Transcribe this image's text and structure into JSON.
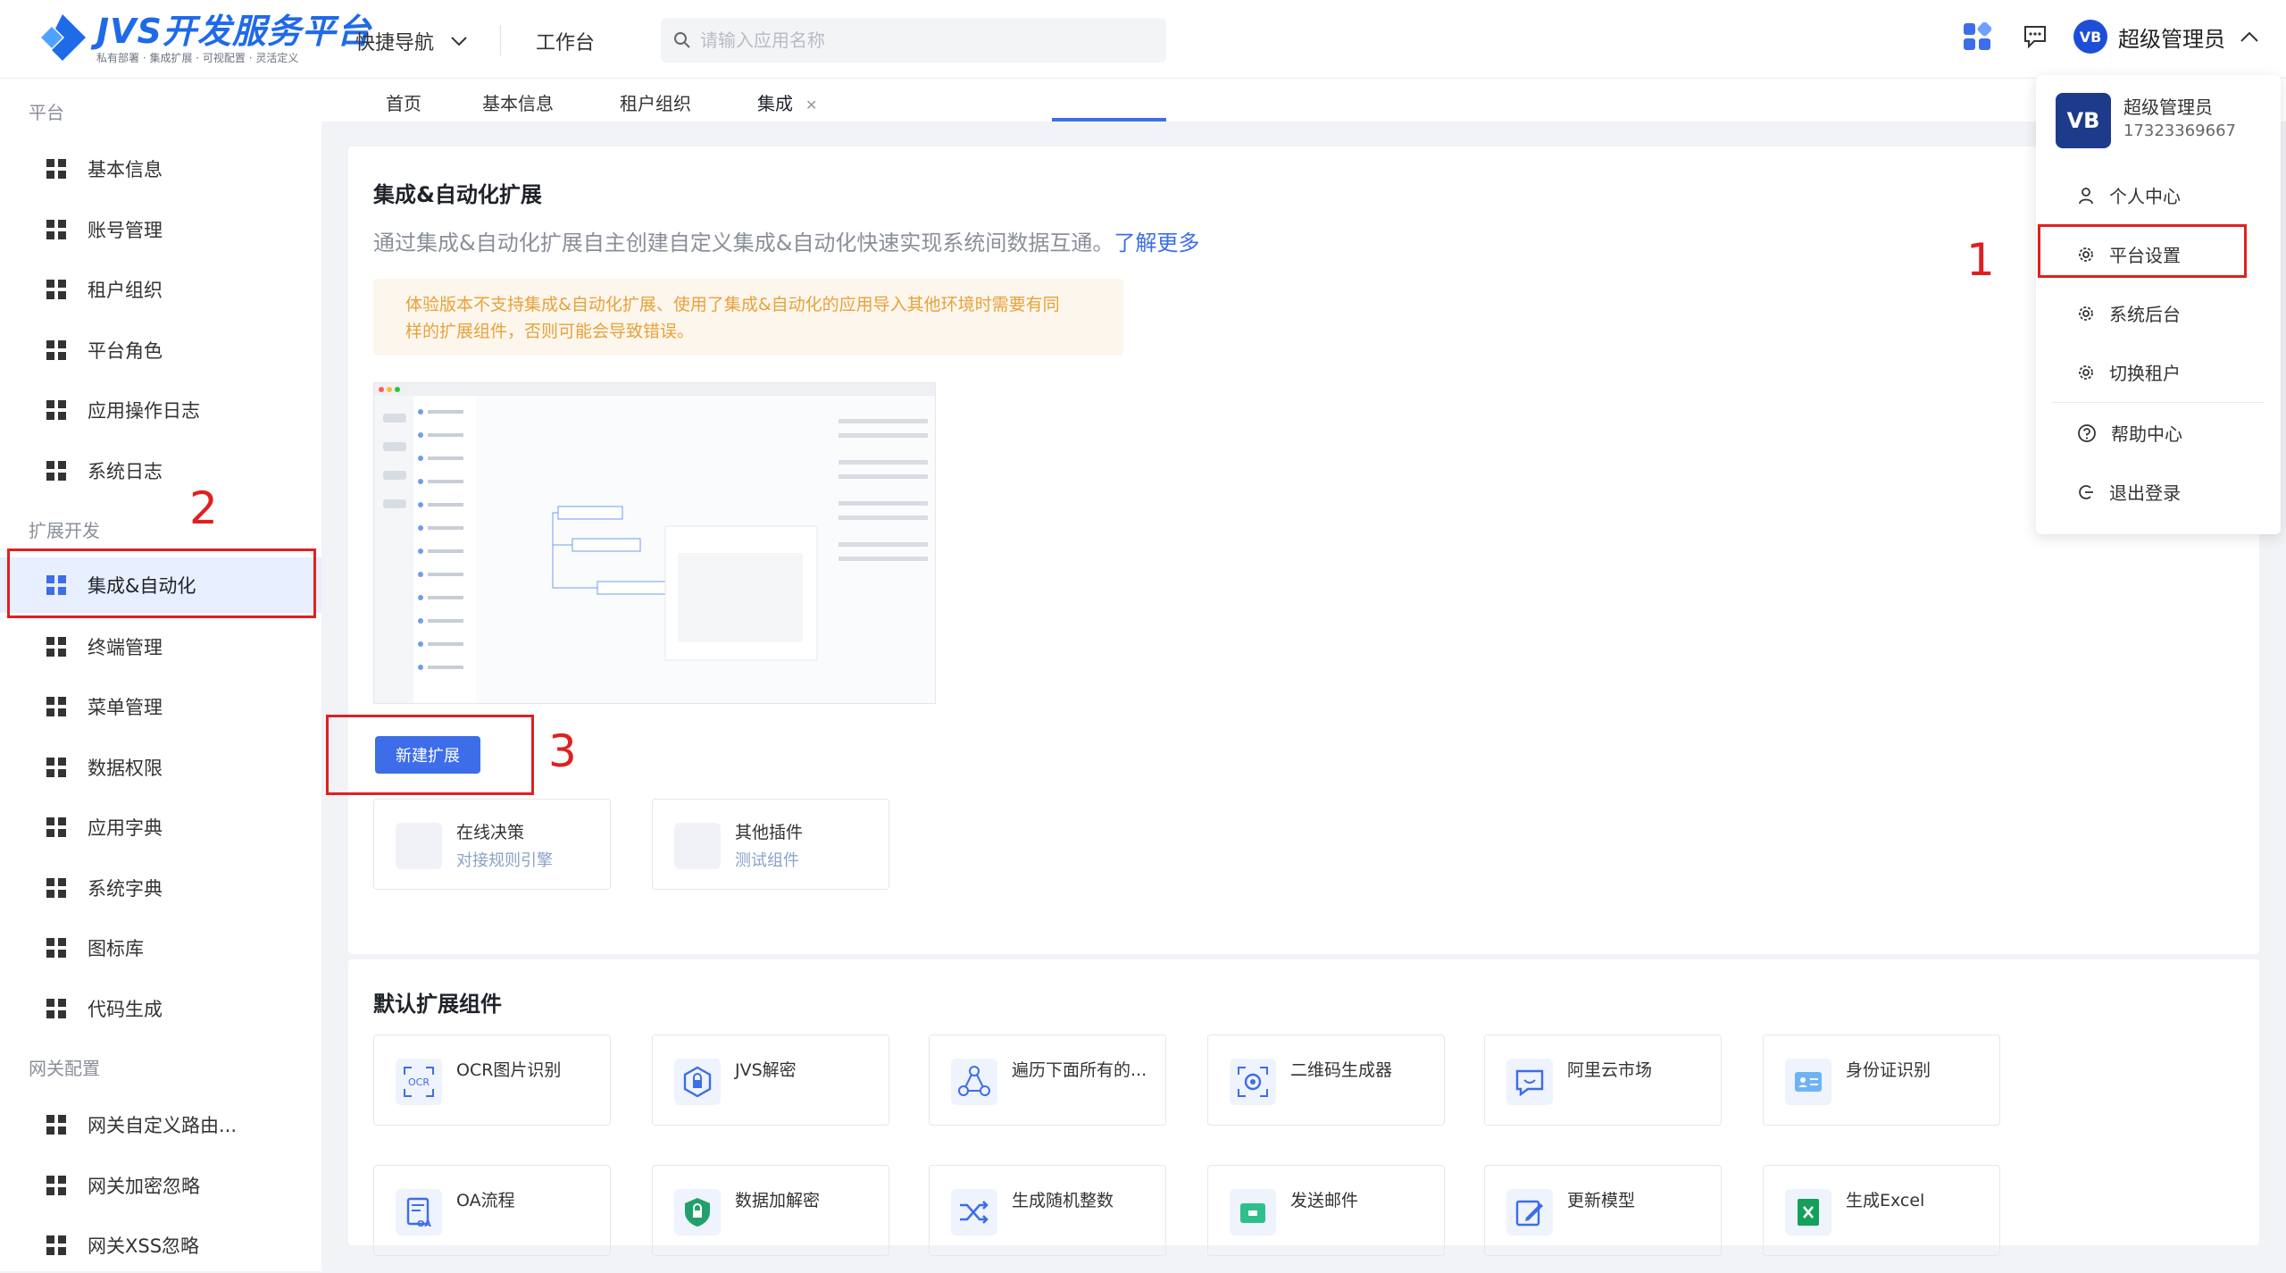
{
  "header": {
    "logo_title": "JVS开发服务平台",
    "logo_sub": "私有部署 · 集成扩展 · 可视配置 · 灵活定义",
    "quicknav": "快捷导航",
    "workbench": "工作台",
    "search_placeholder": "请输入应用名称",
    "user_name": "超级管理员"
  },
  "sidebar": {
    "groups": [
      "平台",
      "扩展开发",
      "网关配置"
    ],
    "items": [
      "基本信息",
      "账号管理",
      "租户组织",
      "平台角色",
      "应用操作日志",
      "系统日志",
      "集成&自动化",
      "终端管理",
      "菜单管理",
      "数据权限",
      "应用字典",
      "系统字典",
      "图标库",
      "代码生成",
      "网关自定义路由...",
      "网关加密忽略",
      "网关XSS忽略"
    ]
  },
  "tabs": [
    "首页",
    "基本信息",
    "租户组织",
    "集成"
  ],
  "main": {
    "title": "集成&自动化扩展",
    "desc": "通过集成&自动化扩展自主创建自定义集成&自动化快速实现系统间数据互通。",
    "learn_more": "了解更多",
    "warning_line1": "体验版本不支持集成&自动化扩展、使用了集成&自动化的应用导入其他环境时需要有同",
    "warning_line2": "样的扩展组件，否则可能会导致错误。",
    "new_button": "新建扩展",
    "plugins": [
      {
        "title": "在线决策",
        "sub": "对接规则引擎"
      },
      {
        "title": "其他插件",
        "sub": "测试组件"
      }
    ],
    "default_title": "默认扩展组件",
    "components": [
      "OCR图片识别",
      "JVS解密",
      "遍历下面所有的...",
      "二维码生成器",
      "阿里云市场",
      "身份证识别",
      "OA流程",
      "数据加解密",
      "生成随机整数",
      "发送邮件",
      "更新模型",
      "生成Excel"
    ]
  },
  "dropdown": {
    "name": "超级管理员",
    "phone": "17323369667",
    "items": [
      "个人中心",
      "平台设置",
      "系统后台",
      "切换租户",
      "帮助中心",
      "退出登录"
    ]
  },
  "annotations": [
    "1",
    "2",
    "3"
  ],
  "colors": {
    "accent": "#3d6de8",
    "annotation": "#e02020",
    "warning_text": "#e6a23c"
  }
}
